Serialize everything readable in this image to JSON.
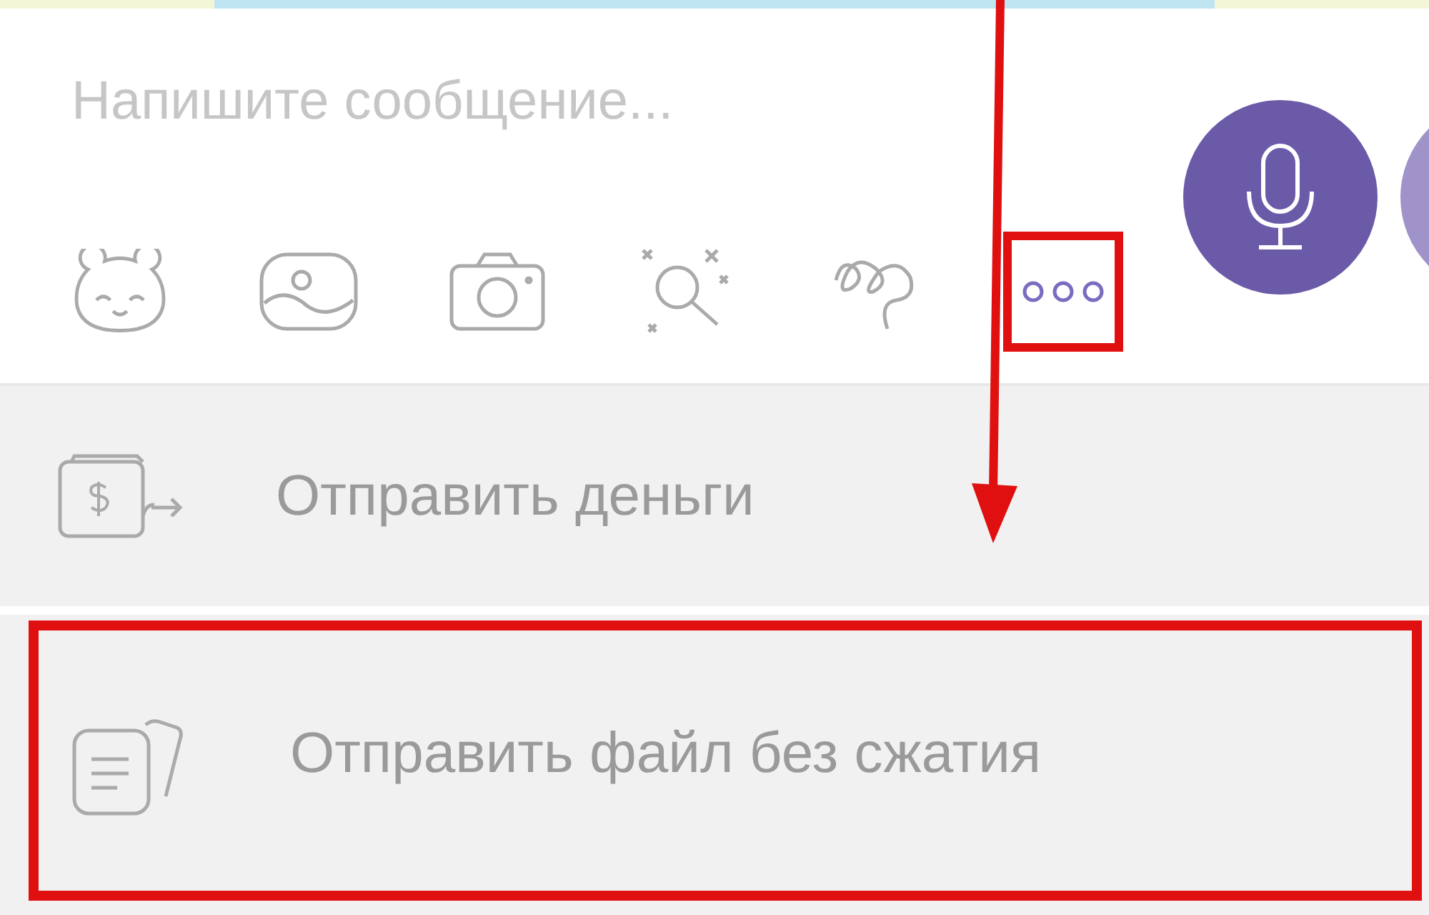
{
  "composer": {
    "placeholder": "Напишите сообщение...",
    "toolbar": [
      {
        "kind": "sticker",
        "highlighted": false
      },
      {
        "kind": "gallery",
        "highlighted": false
      },
      {
        "kind": "camera",
        "highlighted": false
      },
      {
        "kind": "gif-search",
        "highlighted": false
      },
      {
        "kind": "doodle",
        "highlighted": false
      },
      {
        "kind": "more",
        "highlighted": true
      }
    ]
  },
  "menu": [
    {
      "kind": "money",
      "label": "Отправить деньги",
      "highlighted": false
    },
    {
      "kind": "file",
      "label": "Отправить файл без сжатия",
      "highlighted": true
    }
  ],
  "annotation_arrow": true
}
